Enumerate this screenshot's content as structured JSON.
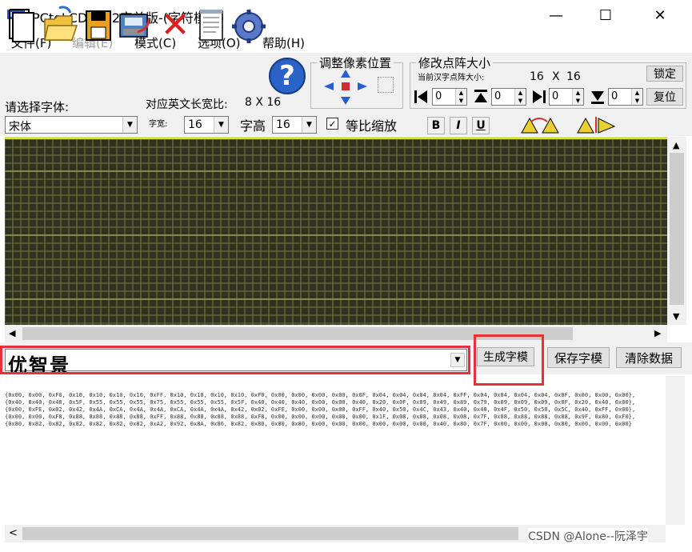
{
  "window": {
    "title": "PCtoLCD2002完美版-(字符模式)",
    "minimize": "—",
    "maximize": "☐",
    "close": "✕"
  },
  "menu": [
    "文件(F)",
    "编辑(E)",
    "模式(C)",
    "选项(O)",
    "帮助(H)"
  ],
  "toolbar": {
    "icons": [
      "new-document-icon",
      "open-folder-icon",
      "save-disk-icon",
      "save-as-icon",
      "delete-x-icon",
      "notepad-icon",
      "settings-gear-icon",
      "help-question-icon"
    ],
    "help_glyph": "?",
    "delete_glyph": "✕"
  },
  "font": {
    "label": "请选择字体:",
    "selected": "宋体",
    "english_ratio_label": "对应英文长宽比:",
    "english_ratio_value": "8 X 16",
    "width_label": "字宽:",
    "width_value": "16",
    "height_label": "字高",
    "height_value": "16",
    "proportional_label": "等比缩放",
    "proportional_checked": "✓",
    "bold": "B",
    "italic": "I",
    "underline": "U"
  },
  "pixel_adjust": {
    "title": "调整像素位置"
  },
  "dot_matrix": {
    "title": "修改点阵大小",
    "current_label": "当前汉字点阵大小:",
    "current_w": "16",
    "current_x": "X",
    "current_h": "16",
    "lock_button": "锁定",
    "reset_button": "复位",
    "spins": [
      "0",
      "0",
      "0",
      "0"
    ]
  },
  "input": {
    "text": "优智景",
    "generate_button": "生成字模",
    "save_button": "保存字模",
    "clear_button": "清除数据"
  },
  "output_lines": [
    "{0x00, 0x00, 0xF0, 0x10, 0x10, 0x10, 0x10, 0xFF, 0x10, 0x10, 0x10, 0x10, 0xF0, 0x00, 0x00, 0x00, 0x00, 0x0F, 0x04, 0x04, 0x04, 0x04, 0xFF, 0x04, 0x04, 0x04, 0x04, 0x0F, 0x00, 0x00, 0x00},",
    "{0x40, 0x40, 0x40, 0x5F, 0x55, 0x55, 0x55, 0x75, 0x55, 0x55, 0x55, 0x5F, 0x40, 0x40, 0x40, 0x00, 0x00, 0x40, 0x20, 0x0F, 0x09, 0x49, 0x89, 0x79, 0x09, 0x09, 0x09, 0x0F, 0x20, 0x40, 0x00},",
    "{0x00, 0xFE, 0x02, 0x42, 0x4A, 0xCA, 0x4A, 0x4A, 0xCA, 0x4A, 0x4A, 0x42, 0x02, 0xFE, 0x00, 0x00, 0x00, 0xFF, 0x40, 0x50, 0x4C, 0x43, 0x40, 0x40, 0x4F, 0x50, 0x50, 0x5C, 0x40, 0xFF, 0x00},",
    "{0x00, 0x00, 0xF8, 0x88, 0x88, 0x88, 0x88, 0xFF, 0x88, 0x88, 0x88, 0x88, 0xF8, 0x00, 0x00, 0x00, 0x00, 0x00, 0x1F, 0x08, 0x08, 0x08, 0x08, 0x7F, 0x88, 0x88, 0x88, 0x88, 0x9F, 0x80, 0xF0},",
    "{0x80, 0x82, 0x82, 0x82, 0x82, 0x82, 0x82, 0xA2, 0x92, 0x8A, 0x86, 0x82, 0x80, 0x80, 0x80, 0x00, 0x00, 0x00, 0x00, 0x00, 0x00, 0x40, 0x80, 0x7F, 0x00, 0x00, 0x00, 0x00, 0x00, 0x00, 0x00}"
  ],
  "scroll": {
    "left": "◀",
    "right": "▶",
    "up": "▲",
    "down": "▼",
    "small_left": "<",
    "small_right": ">"
  },
  "watermark": "CSDN @Alone--阮泽宇",
  "colors": {
    "canvas_bg": "#313120",
    "grid_line": "#6e7a3a",
    "grid_border": "#e6e600",
    "highlight": "#e8303a"
  }
}
